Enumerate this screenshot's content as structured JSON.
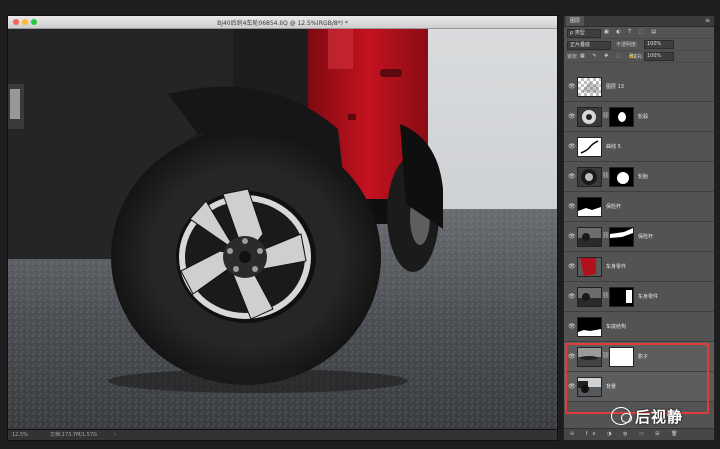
{
  "document": {
    "title": "BJ40后刹4车轮06854.IIQ @ 12.5%(RGB/8*) *",
    "status_zoom": "12.5%",
    "status_doc": "文档:173.7M/1.57G",
    "status_arrow": "›"
  },
  "layers_panel": {
    "tab": "图层",
    "menu_icon": "≡",
    "filter_kind": "ρ 类型",
    "filter_icons": "▣ ◐ T ⬚ ▤",
    "blend_mode": "正片叠底",
    "opacity_label": "不透明度:",
    "opacity_value": "100%",
    "lock_label": "锁定:",
    "lock_icons": "▦ ✎ ✥ ⬚ 🔒",
    "fill_label": "填充:",
    "fill_value": "100%",
    "footer_icons": "⊝ fx ◑ ◍ ▭ ⊞ 🗑",
    "layers": [
      {
        "name": "图层 13",
        "has_mask": false,
        "thumb": "checker"
      },
      {
        "name": "轮毂",
        "has_mask": true,
        "thumb": "wheel",
        "mask": "white-blob"
      },
      {
        "name": "曲线 5",
        "has_mask": false,
        "thumb": "curves"
      },
      {
        "name": "轮胎",
        "has_mask": true,
        "thumb": "wheel",
        "mask": "white-round"
      },
      {
        "name": "保险杆",
        "has_mask": false,
        "thumb": "dark-white-bottom"
      },
      {
        "name": "保险杆",
        "has_mask": true,
        "thumb": "gray-car",
        "mask": "white-top"
      },
      {
        "name": "车身零件",
        "has_mask": false,
        "thumb": "red-car"
      },
      {
        "name": "车身零件",
        "has_mask": true,
        "thumb": "gray-car",
        "mask": "white-right"
      },
      {
        "name": "车底结构",
        "has_mask": false,
        "thumb": "dark-white-bottom"
      },
      {
        "name": "影子",
        "has_mask": true,
        "thumb": "shadow",
        "mask": "white-full"
      },
      {
        "name": "背景",
        "has_mask": false,
        "thumb": "photo"
      }
    ]
  },
  "watermark": {
    "text": "后视静"
  },
  "colors": {
    "panel_bg": "#535353",
    "highlight_outline": "#e23b3b",
    "car_red": "#b3111c"
  }
}
